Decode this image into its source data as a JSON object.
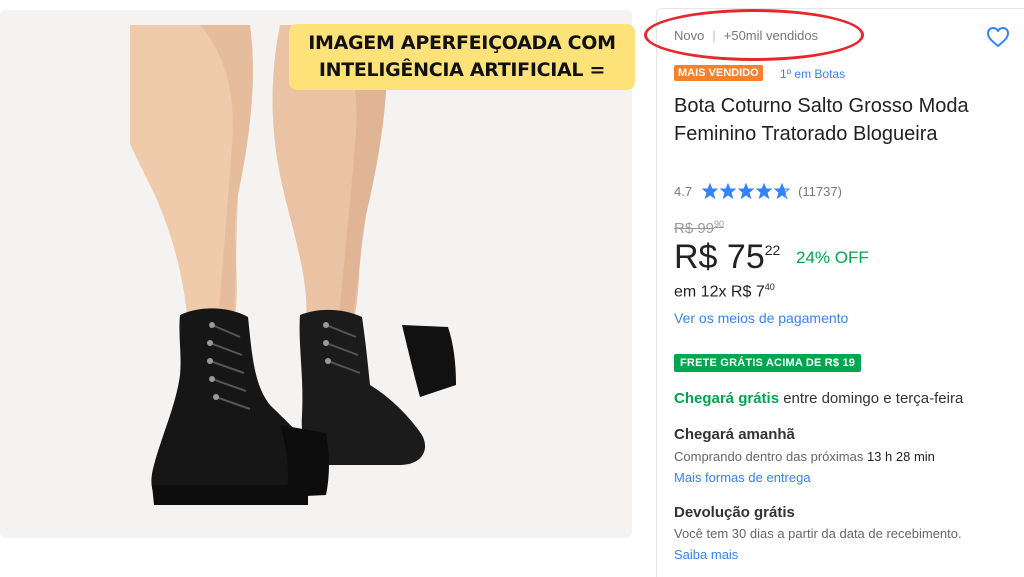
{
  "overlay": {
    "line1": "IMAGEM APERFEIÇOADA COM",
    "line2": "INTELIGÊNCIA ARTIFICIAL ="
  },
  "header": {
    "condition": "Novo",
    "separator": "|",
    "sold": "+50mil vendidos"
  },
  "badge": {
    "best_seller": "MAIS VENDIDO",
    "rank": "1º em Botas"
  },
  "product": {
    "title": "Bota Coturno Salto Grosso Moda Feminino Tratorado Blogueira"
  },
  "rating": {
    "score": "4.7",
    "stars": 4.7,
    "count": "(11737)"
  },
  "price": {
    "old_whole": "R$ 99",
    "old_cents": "90",
    "current_whole": "R$ 75",
    "current_cents": "22",
    "discount": "24% OFF",
    "installment_prefix": "em 12x",
    "installment_whole": "R$ 7",
    "installment_cents": "40",
    "payment_link": "Ver os meios de pagamento"
  },
  "shipping": {
    "free_badge": "FRETE GRÁTIS ACIMA DE R$ 19",
    "arrives_free_green": "Chegará grátis",
    "arrives_free_rest": "entre domingo e terça-feira",
    "arrives_tomorrow": "Chegará amanhã",
    "buying_within_prefix": "Comprando dentro das próximas",
    "buying_within_time": "13 h 28 min",
    "more_options_link": "Mais formas de entrega"
  },
  "returns": {
    "title": "Devolução grátis",
    "text": "Você tem 30 dias a partir da data de recebimento.",
    "link": "Saiba mais"
  },
  "colors": {
    "accent_blue": "#3483fa",
    "green": "#00a650",
    "orange": "#f5812c",
    "highlight_yellow": "#fde27a",
    "annotation_red": "#e8262b"
  }
}
